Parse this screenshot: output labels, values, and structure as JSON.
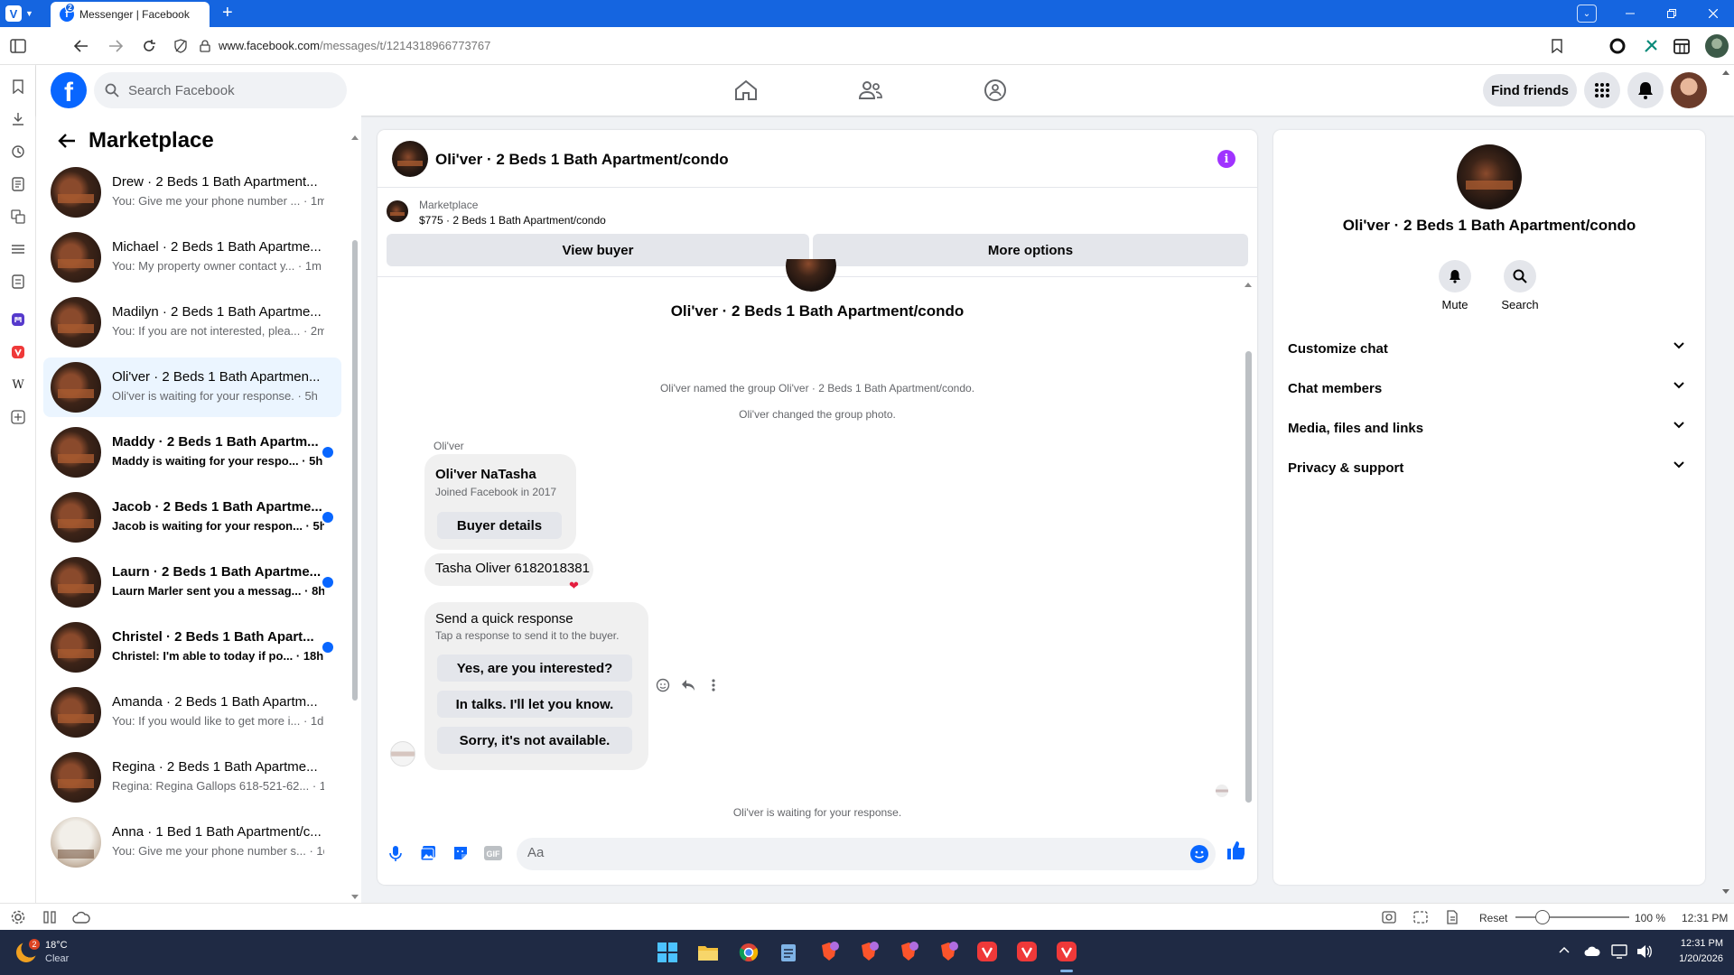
{
  "browser": {
    "tab_title": "Messenger | Facebook",
    "tab_badge": "2",
    "new_tab": "+",
    "url_domain": "www.facebook.com",
    "url_path": "/messages/t/1214318966773767"
  },
  "fb_header": {
    "logo_letter": "f",
    "search_placeholder": "Search Facebook",
    "find_friends": "Find friends"
  },
  "left": {
    "title": "Marketplace",
    "chats": [
      {
        "name": "Drew · 2 Beds 1 Bath Apartment...",
        "snippet": "You: Give me your phone number ... · 1m",
        "unread": false,
        "active": false,
        "thumb": "dark"
      },
      {
        "name": "Michael · 2 Beds 1 Bath Apartme...",
        "snippet": "You: My property owner contact y... · 1m",
        "unread": false,
        "active": false,
        "thumb": "dark"
      },
      {
        "name": "Madilyn · 2 Beds 1 Bath Apartme...",
        "snippet": "You: If you are not interested, plea... · 2m",
        "unread": false,
        "active": false,
        "thumb": "dark"
      },
      {
        "name": "Oli'ver · 2 Beds 1 Bath Apartmen...",
        "snippet": "Oli'ver is waiting for your response. · 5h",
        "unread": false,
        "active": true,
        "thumb": "dark"
      },
      {
        "name": "Maddy · 2 Beds 1 Bath Apartm...",
        "snippet": "Maddy is waiting for your respo... · 5h",
        "unread": true,
        "active": false,
        "thumb": "dark"
      },
      {
        "name": "Jacob · 2 Beds 1 Bath Apartme...",
        "snippet": "Jacob is waiting for your respon... · 5h",
        "unread": true,
        "active": false,
        "thumb": "dark"
      },
      {
        "name": "Laurn · 2 Beds 1 Bath Apartme...",
        "snippet": "Laurn Marler sent you a messag... · 8h",
        "unread": true,
        "active": false,
        "thumb": "dark"
      },
      {
        "name": "Christel · 2 Beds 1 Bath Apart...",
        "snippet": "Christel: I'm able to today if po... · 18h",
        "unread": true,
        "active": false,
        "thumb": "dark"
      },
      {
        "name": "Amanda · 2 Beds 1 Bath Apartm...",
        "snippet": "You: If you would like to get more i... · 1d",
        "unread": false,
        "active": false,
        "thumb": "dark"
      },
      {
        "name": "Regina · 2 Beds 1 Bath Apartme...",
        "snippet": "Regina: Regina Gallops 618-521-62... · 1d",
        "unread": false,
        "active": false,
        "thumb": "dark"
      },
      {
        "name": "Anna · 1 Bed 1 Bath Apartment/c...",
        "snippet": "You: Give me your phone number s... · 1d",
        "unread": false,
        "active": false,
        "thumb": "light"
      }
    ]
  },
  "conversation": {
    "title": "Oli'ver · 2 Beds 1 Bath Apartment/condo",
    "marketplace_label": "Marketplace",
    "listing": "$775 · 2 Beds 1 Bath Apartment/condo",
    "view_buyer": "View buyer",
    "more_options": "More options",
    "big_title": "Oli'ver · 2 Beds 1 Bath Apartment/condo",
    "sys_named": "Oli'ver named the group Oli'ver · 2 Beds 1 Bath Apartment/condo.",
    "sys_photo": "Oli'ver changed the group photo.",
    "sender": "Oli'ver",
    "card_name": "Oli'ver NaTasha",
    "card_joined": "Joined Facebook in 2017",
    "buyer_details": "Buyer details",
    "phone_msg": "Tasha Oliver 6182018381",
    "heart": "❤",
    "qr_title": "Send a quick response",
    "qr_sub": "Tap a response to send it to the buyer.",
    "qr_options": [
      "Yes, are you interested?",
      "In talks. I'll let you know.",
      "Sorry, it's not available."
    ],
    "waiting": "Oli'ver is waiting for your response.",
    "input_placeholder": "Aa"
  },
  "right": {
    "title": "Oli'ver · 2 Beds 1 Bath Apartment/condo",
    "mute": "Mute",
    "search": "Search",
    "rows": [
      "Customize chat",
      "Chat members",
      "Media, files and links",
      "Privacy & support"
    ]
  },
  "status": {
    "reset": "Reset",
    "zoom": "100 %",
    "zoom_level": 0.2,
    "time_short": "12:31 PM"
  },
  "taskbar": {
    "weather_temp": "18°C",
    "weather_desc": "Clear",
    "weather_badge": "2",
    "time": "12:31 PM",
    "date": "1/20/2026"
  },
  "colors": {
    "fb_blue": "#0866ff",
    "browser_blue": "#1565e0",
    "info_purple": "#a033ff",
    "heart_red": "#e41e3f"
  },
  "icons": {
    "nav": [
      "home-icon",
      "friends-icon",
      "groups-icon"
    ],
    "right_header": [
      "apps-grid-icon",
      "bell-icon"
    ],
    "composer": [
      "mic-icon",
      "photo-icon",
      "sticker-icon",
      "gif-icon",
      "emoji-icon",
      "thumbs-up-icon"
    ]
  }
}
